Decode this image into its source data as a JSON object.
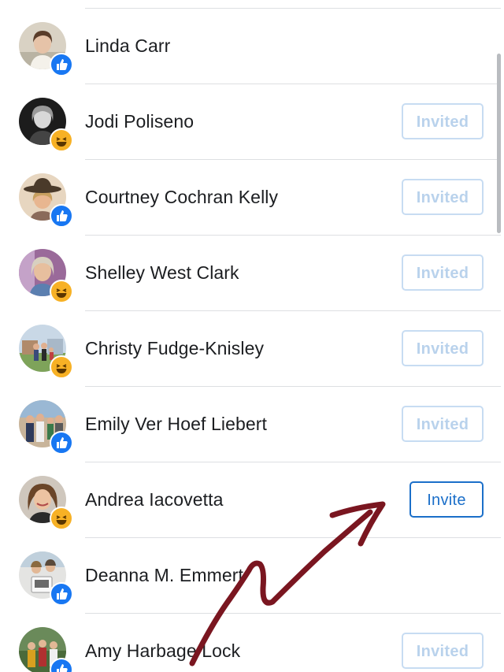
{
  "people": [
    {
      "name": "Linda Carr",
      "reaction": "like",
      "button": ""
    },
    {
      "name": "Jodi Poliseno",
      "reaction": "haha",
      "button": "Invited"
    },
    {
      "name": "Courtney Cochran Kelly",
      "reaction": "like",
      "button": "Invited"
    },
    {
      "name": "Shelley West Clark",
      "reaction": "haha",
      "button": "Invited"
    },
    {
      "name": "Christy Fudge-Knisley",
      "reaction": "haha",
      "button": "Invited"
    },
    {
      "name": "Emily Ver Hoef Liebert",
      "reaction": "like",
      "button": "Invited"
    },
    {
      "name": "Andrea Iacovetta",
      "reaction": "haha",
      "button": "Invite"
    },
    {
      "name": "Deanna M. Emmert",
      "reaction": "like",
      "button": ""
    },
    {
      "name": "Amy Harbage Lock",
      "reaction": "like",
      "button": "Invited"
    }
  ],
  "reaction_icons": {
    "like": "thumbs-up-icon",
    "haha": "laughing-face-icon"
  },
  "colors": {
    "like_badge": "#1877f2",
    "haha_badge": "#f7b125",
    "invite_button": "#1b6fc9",
    "invited_button": "#b9d2ec",
    "annotation_arrow": "#7a1620"
  }
}
